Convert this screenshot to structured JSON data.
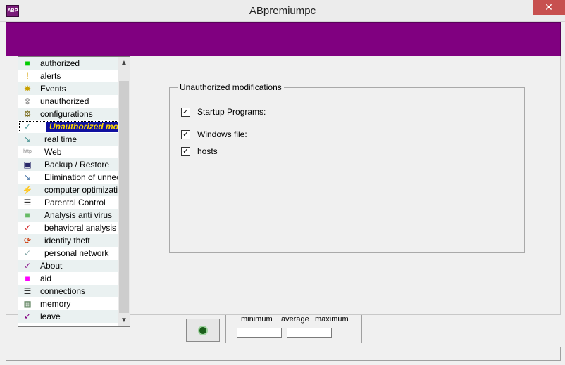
{
  "window": {
    "title": "ABpremiumpc",
    "app_icon_text": "ABP",
    "close_glyph": "✕"
  },
  "sidebar": {
    "items": [
      {
        "label": "authorized",
        "icon": "green-square-icon",
        "glyph": "■",
        "color": "#00cc00"
      },
      {
        "label": "alerts",
        "icon": "alert-icon",
        "glyph": "!",
        "color": "#d4a000"
      },
      {
        "label": "Events",
        "icon": "lightbulb-icon",
        "glyph": "✸",
        "color": "#c8a000"
      },
      {
        "label": "unauthorized",
        "icon": "forbidden-icon",
        "glyph": "⊗",
        "color": "#888888"
      },
      {
        "label": "configurations",
        "icon": "configurations-icon",
        "glyph": "⚙",
        "color": "#6a5a00"
      },
      {
        "label": "Unauthorized mo",
        "icon": "check-icon",
        "glyph": "✓",
        "color": "#5aa0a0",
        "selected": true
      },
      {
        "label": "real time",
        "icon": "realtime-icon",
        "glyph": "↘",
        "color": "#3a8a8a",
        "indent": true
      },
      {
        "label": "Web",
        "icon": "web-icon",
        "glyph": "http",
        "color": "#888888",
        "indent": true
      },
      {
        "label": "Backup / Restore",
        "icon": "backup-icon",
        "glyph": "▣",
        "color": "#2a2a6a",
        "indent": true
      },
      {
        "label": "Elimination of unnecessary",
        "icon": "elimination-icon",
        "glyph": "↘",
        "color": "#3a6aa0",
        "indent": true
      },
      {
        "label": "computer optimization",
        "icon": "optimization-icon",
        "glyph": "⚡",
        "color": "#3a6aa0",
        "indent": true
      },
      {
        "label": "Parental Control",
        "icon": "parental-control-icon",
        "glyph": "☰",
        "color": "#333333",
        "indent": true
      },
      {
        "label": "Analysis anti virus",
        "icon": "antivirus-icon",
        "glyph": "■",
        "color": "#66bb66",
        "indent": true
      },
      {
        "label": "behavioral analysis",
        "icon": "behavioral-check-icon",
        "glyph": "✓",
        "color": "#cc0000",
        "indent": true
      },
      {
        "label": "identity theft",
        "icon": "identity-theft-icon",
        "glyph": "⟳",
        "color": "#cc3300",
        "indent": true
      },
      {
        "label": "personal network",
        "icon": "network-check-icon",
        "glyph": "✓",
        "color": "#88aaaa",
        "indent": true
      },
      {
        "label": "About",
        "icon": "about-check-icon",
        "glyph": "✓",
        "color": "#800080"
      },
      {
        "label": "aid",
        "icon": "magenta-square-icon",
        "glyph": "■",
        "color": "#ff00ff"
      },
      {
        "label": "connections",
        "icon": "connections-icon",
        "glyph": "☰",
        "color": "#333333"
      },
      {
        "label": "memory",
        "icon": "memory-icon",
        "glyph": "▦",
        "color": "#668866"
      },
      {
        "label": "leave",
        "icon": "leave-check-icon",
        "glyph": "✓",
        "color": "#800080"
      }
    ]
  },
  "main": {
    "group_title": "Unauthorized modifications",
    "checks": [
      {
        "label": "Startup Programs:",
        "checked": true
      },
      {
        "label": "Windows file:",
        "checked": true
      },
      {
        "label": "hosts",
        "checked": true
      }
    ]
  },
  "stats": {
    "minimum_label": "minimum",
    "average_label": "average",
    "maximum_label": "maximum"
  },
  "colors": {
    "banner": "#800080"
  }
}
